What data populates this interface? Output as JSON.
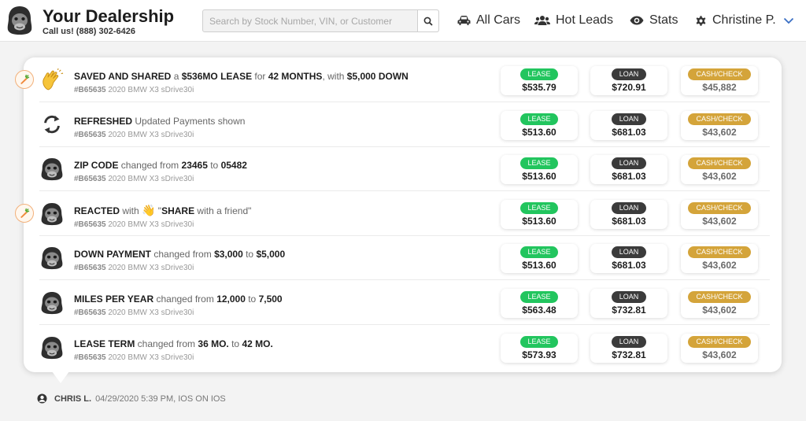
{
  "header": {
    "brand_title": "Your Dealership",
    "brand_sub": "Call us! (888) 302-6426",
    "search_placeholder": "Search by Stock Number, VIN, or Customer",
    "nav": {
      "all_cars": "All Cars",
      "hot_leads": "Hot Leads",
      "stats": "Stats",
      "user": "Christine P."
    }
  },
  "pill_labels": {
    "lease": "LEASE",
    "loan": "LOAN",
    "cash": "CASH/CHECK"
  },
  "rows": [
    {
      "icon": "clap-icon",
      "carrot": true,
      "parts": [
        {
          "t": "SAVED AND SHARED",
          "b": true
        },
        {
          "t": " a ",
          "b": false
        },
        {
          "t": "$536MO LEASE",
          "b": true
        },
        {
          "t": " for ",
          "b": false
        },
        {
          "t": "42 MONTHS",
          "b": true
        },
        {
          "t": ", with ",
          "b": false
        },
        {
          "t": "$5,000 DOWN",
          "b": true
        }
      ],
      "stock": "#B65635",
      "vehicle": " 2020 BMW X3 sDrive30i",
      "lease": "$535.79",
      "loan": "$720.91",
      "cash": "$45,882"
    },
    {
      "icon": "refresh-icon",
      "carrot": false,
      "parts": [
        {
          "t": "REFRESHED",
          "b": true
        },
        {
          "t": " Updated Payments shown",
          "b": false
        }
      ],
      "stock": "#B65635",
      "vehicle": " 2020 BMW X3 sDrive30i",
      "lease": "$513.60",
      "loan": "$681.03",
      "cash": "$43,602"
    },
    {
      "icon": "gorilla-icon",
      "carrot": false,
      "parts": [
        {
          "t": "ZIP CODE",
          "b": true
        },
        {
          "t": " changed from ",
          "b": false
        },
        {
          "t": "23465",
          "b": true
        },
        {
          "t": " to ",
          "b": false
        },
        {
          "t": "05482",
          "b": true
        }
      ],
      "stock": "#B65635",
      "vehicle": " 2020 BMW X3 sDrive30i",
      "lease": "$513.60",
      "loan": "$681.03",
      "cash": "$43,602"
    },
    {
      "icon": "gorilla-icon",
      "carrot": true,
      "parts": [
        {
          "t": "REACTED",
          "b": true
        },
        {
          "t": " with ",
          "b": false
        },
        {
          "t": "👋",
          "b": false,
          "emoji": true
        },
        {
          "t": " \"",
          "b": false
        },
        {
          "t": "SHARE",
          "b": true
        },
        {
          "t": " with a friend\"",
          "b": false
        }
      ],
      "stock": "#B65635",
      "vehicle": " 2020 BMW X3 sDrive30i",
      "lease": "$513.60",
      "loan": "$681.03",
      "cash": "$43,602"
    },
    {
      "icon": "gorilla-icon",
      "carrot": false,
      "parts": [
        {
          "t": "DOWN PAYMENT",
          "b": true
        },
        {
          "t": " changed from ",
          "b": false
        },
        {
          "t": "$3,000",
          "b": true
        },
        {
          "t": " to ",
          "b": false
        },
        {
          "t": "$5,000",
          "b": true
        }
      ],
      "stock": "#B65635",
      "vehicle": " 2020 BMW X3 sDrive30i",
      "lease": "$513.60",
      "loan": "$681.03",
      "cash": "$43,602"
    },
    {
      "icon": "gorilla-icon",
      "carrot": false,
      "parts": [
        {
          "t": "MILES PER YEAR",
          "b": true
        },
        {
          "t": " changed from ",
          "b": false
        },
        {
          "t": "12,000",
          "b": true
        },
        {
          "t": " to ",
          "b": false
        },
        {
          "t": "7,500",
          "b": true
        }
      ],
      "stock": "#B65635",
      "vehicle": " 2020 BMW X3 sDrive30i",
      "lease": "$563.48",
      "loan": "$732.81",
      "cash": "$43,602"
    },
    {
      "icon": "gorilla-icon",
      "carrot": false,
      "parts": [
        {
          "t": "LEASE TERM",
          "b": true
        },
        {
          "t": " changed from ",
          "b": false
        },
        {
          "t": "36 MO.",
          "b": true
        },
        {
          "t": " to ",
          "b": false
        },
        {
          "t": "42 MO.",
          "b": true
        }
      ],
      "stock": "#B65635",
      "vehicle": " 2020 BMW X3 sDrive30i",
      "lease": "$573.93",
      "loan": "$732.81",
      "cash": "$43,602"
    }
  ],
  "footer": {
    "name": "CHRIS L.",
    "datetime": "04/29/2020 5:39 PM",
    "platform": ", IOS ON IOS"
  },
  "colors": {
    "lease": "#22c55e",
    "loan": "#3b3b3b",
    "cash": "#d4a43a",
    "carrot": "#f08a3c"
  }
}
